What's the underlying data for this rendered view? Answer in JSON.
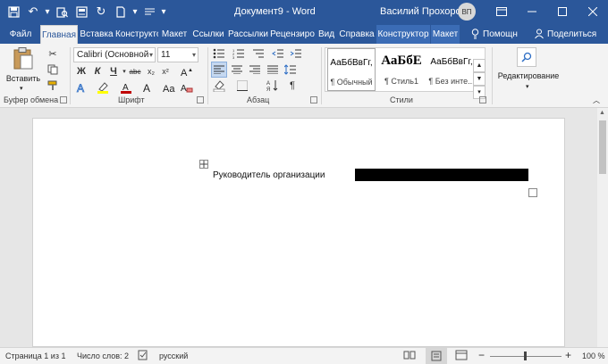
{
  "titlebar": {
    "doc_title": "Документ9 - Word",
    "user_name": "Василий Прохоров",
    "avatar_initials": "ВП",
    "qat_icons": [
      "save-icon",
      "undo-icon",
      "print-preview-icon",
      "save-as-icon",
      "redo-icon",
      "new-doc-icon",
      "format-icon",
      "customize-icon"
    ],
    "window_buttons": [
      "ribbon-display-icon",
      "minimize-icon",
      "restore-icon",
      "close-icon"
    ]
  },
  "tabs": {
    "file": "Файл",
    "home": "Главная",
    "insert": "Вставка",
    "design": "Конструктор",
    "layout": "Макет",
    "references": "Ссылки",
    "mailings": "Рассылки",
    "review": "Рецензиро",
    "view": "Вид",
    "help": "Справка",
    "table_design": "Конструктор",
    "table_layout": "Макет",
    "tell_me": "Помощн",
    "share": "Поделиться"
  },
  "ribbon": {
    "clipboard": {
      "paste_label": "Вставить",
      "group_label": "Буфер обмена"
    },
    "font": {
      "font_name": "Calibri (Основной",
      "font_size": "11",
      "bold": "Ж",
      "italic": "К",
      "underline": "Ч",
      "strike": "abc",
      "subscript": "x₂",
      "superscript": "x²",
      "group_label": "Шрифт"
    },
    "paragraph": {
      "group_label": "Абзац"
    },
    "styles": {
      "items": [
        {
          "sample": "АаБбВвГг,",
          "name": "¶ Обычный"
        },
        {
          "sample": "АаБбЕ",
          "name": "¶ Стиль1"
        },
        {
          "sample": "АаБбВвГг,",
          "name": "¶ Без инте..."
        }
      ],
      "group_label": "Стили"
    },
    "editing": {
      "label": "Редактирование"
    }
  },
  "document": {
    "cell_text": "Руководитель организации"
  },
  "statusbar": {
    "page": "Страница 1 из 1",
    "words": "Число слов: 2",
    "language": "русский",
    "zoom": "100 %"
  },
  "colors": {
    "accent": "#2b579a",
    "ribbon_bg": "#f3f3f3",
    "highlight": "#ffff00",
    "font_color": "#c00000"
  }
}
